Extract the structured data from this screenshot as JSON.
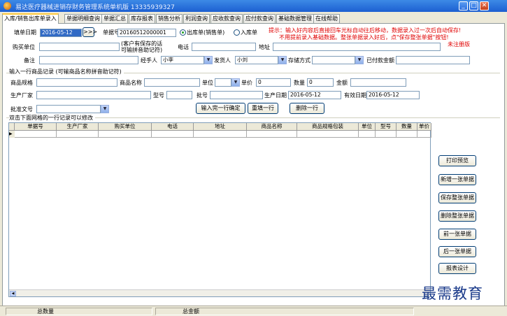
{
  "window": {
    "title": "易达医疗器械进销存财务管理系统单机版 13335939327",
    "min": "_",
    "max": "□",
    "close": "✕"
  },
  "tabs": [
    "入库/销售出库单录入",
    "单据明细查询",
    "单据汇总",
    "库存报表",
    "销售分析",
    "利润查询",
    "应收款查询",
    "应付款查询",
    "基础数据管理",
    "在线帮助"
  ],
  "form": {
    "date_label": "填单日期",
    "date_value": "2016-05-12",
    "more_btn": ">>>",
    "docno_label": "单据号",
    "docno_value": "20160512000001",
    "radio_out": "出库单(销售单)",
    "radio_in": "入库单",
    "buyer_label": "购买单位",
    "buyer_note_1": "(客户有保存的话",
    "buyer_note_2": "可输拼音助记符)",
    "phone_label": "电话",
    "address_label": "地址",
    "remark_label": "备注",
    "handler_label": "经手人",
    "handler_value": "小李",
    "shipper_label": "发货人",
    "shipper_value": "小刘",
    "storage_label": "存储方式",
    "paid_label": "已付款金额",
    "hint_1": "提示：输入好内容后直接回车光标自动往后移动，数据录入过一次后自动保存!",
    "hint_2": "不用提前录入基础数据。整张单据录入好后，点\"保存整张单据\"按钮!",
    "hint_3": "未注册版"
  },
  "line": {
    "section": "输入一行商品记录 (可输商品名称拼音助记符)",
    "spec_label": "商品规格",
    "name_label": "商品名称",
    "unit_label": "单位",
    "price_label": "单价",
    "price_value": "0",
    "qty_label": "数量",
    "qty_value": "0",
    "amount_label": "金额",
    "maker_label": "生产厂家",
    "model_label": "型号",
    "batch_label": "批号",
    "mfg_label": "生产日期",
    "mfg_value": "2016-05-12",
    "exp_label": "有效日期",
    "exp_value": "2016-05-12",
    "approval_label": "批准文号",
    "confirm_btn": "输入完一行确定",
    "refill_btn": "重填一行",
    "delete_btn": "删除一行"
  },
  "grid": {
    "caption": "双击下面网格的一行记录可以修改",
    "columns": [
      "单据号",
      "生产厂家",
      "购买单位",
      "电话",
      "地址",
      "商品名称",
      "商品规格包装",
      "单位",
      "型号",
      "数量",
      "单价"
    ],
    "row_marker": "▶",
    "scroll_left": "◀"
  },
  "side_buttons": [
    "打印预览",
    "新增一张单据",
    "保存整张单据",
    "删除整张单据",
    "前一张单据",
    "后一张单据",
    "报表设计"
  ],
  "status": {
    "total_qty": "总数量",
    "total_amount": "总金额"
  },
  "watermark": "最需教育",
  "colors": {
    "titlebar": "#1c5fd1",
    "hint": "#e00000",
    "selection": "#316ac5"
  }
}
